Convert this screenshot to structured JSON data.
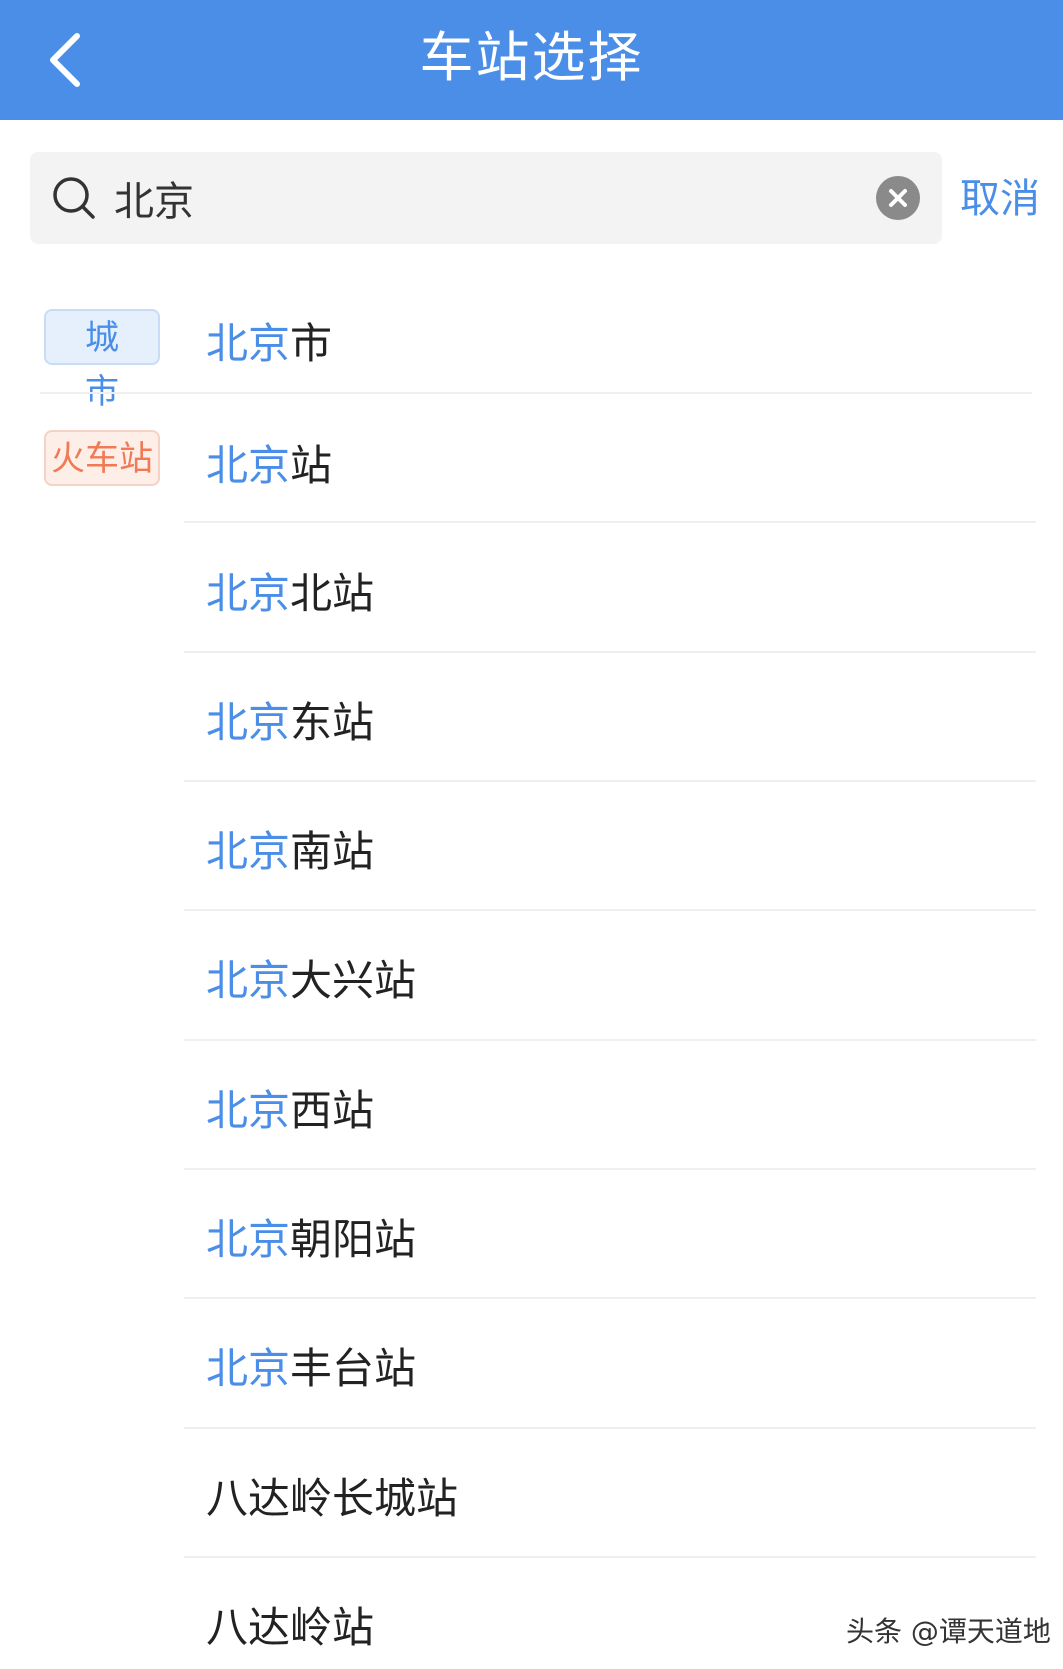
{
  "header": {
    "title": "车站选择"
  },
  "search": {
    "value": "北京",
    "placeholder": "",
    "cancel_label": "取消"
  },
  "results": [
    {
      "badge": "城 市",
      "badge_type": "city",
      "highlight": "北京",
      "rest": "市"
    },
    {
      "badge": "火车站",
      "badge_type": "train",
      "highlight": "北京",
      "rest": "站"
    },
    {
      "badge": "",
      "highlight": "北京",
      "rest": "北站"
    },
    {
      "badge": "",
      "highlight": "北京",
      "rest": "东站"
    },
    {
      "badge": "",
      "highlight": "北京",
      "rest": "南站"
    },
    {
      "badge": "",
      "highlight": "北京",
      "rest": "大兴站"
    },
    {
      "badge": "",
      "highlight": "北京",
      "rest": "西站"
    },
    {
      "badge": "",
      "highlight": "北京",
      "rest": "朝阳站"
    },
    {
      "badge": "",
      "highlight": "北京",
      "rest": "丰台站"
    },
    {
      "badge": "",
      "highlight": "",
      "rest": "八达岭长城站"
    },
    {
      "badge": "",
      "highlight": "",
      "rest": "八达岭站"
    }
  ],
  "watermark": "头条 @谭天道地",
  "colors": {
    "primary": "#4a8ee8",
    "train_badge": "#f07a54",
    "text": "#222222"
  }
}
